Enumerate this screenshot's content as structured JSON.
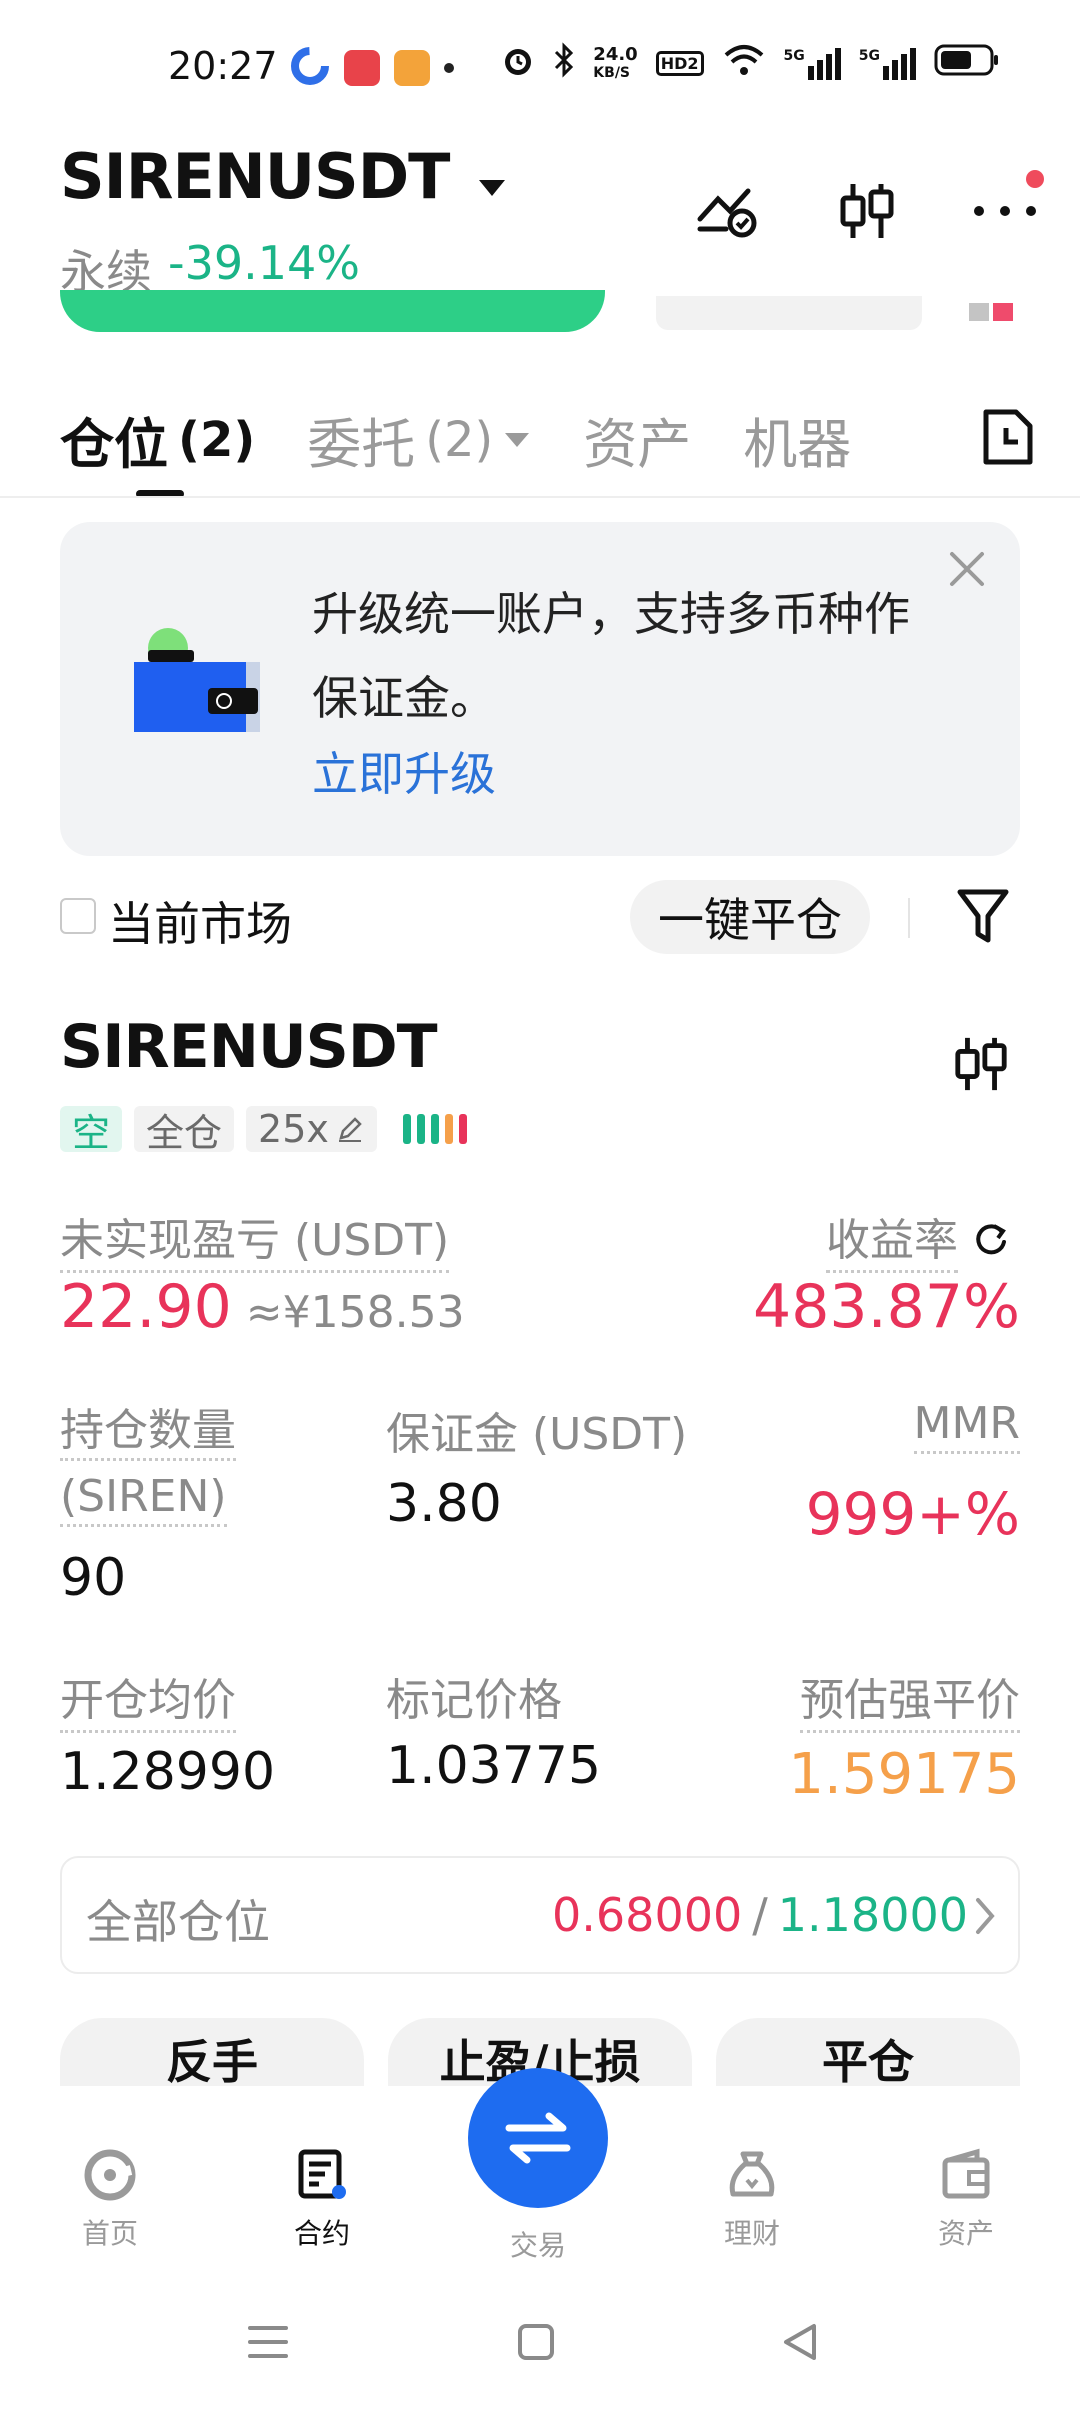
{
  "status_bar": {
    "time": "20:27",
    "net_speed_top": "24.0",
    "net_speed_unit": "KB/S",
    "hd_label": "HD2",
    "sig1": "5G",
    "sig2": "5G"
  },
  "header": {
    "pair": "SIRENUSDT",
    "contract_type": "永续",
    "change": "-39.14%"
  },
  "tabs": [
    {
      "label": "仓位",
      "count": "(2)"
    },
    {
      "label": "委托",
      "count": "(2)"
    },
    {
      "label": "资产",
      "count": ""
    },
    {
      "label": "机器",
      "count": ""
    }
  ],
  "banner": {
    "text": "升级统一账户，支持多币种作保证金。",
    "link": "立即升级"
  },
  "filter": {
    "current_market": "当前市场",
    "close_all": "一键平仓"
  },
  "position": {
    "symbol": "SIRENUSDT",
    "side": "空",
    "margin_mode": "全仓",
    "leverage": "25x",
    "upnl_label": "未实现盈亏 (USDT)",
    "upnl": "22.90",
    "upnl_cny": "≈¥158.53",
    "roe_label": "收益率",
    "roe": "483.87%",
    "qty_label_1": "持仓数量",
    "qty_label_2": "(SIREN)",
    "qty": "90",
    "margin_label": "保证金 (USDT)",
    "margin": "3.80",
    "mmr_label": "MMR",
    "mmr": "999+%",
    "entry_label": "开仓均价",
    "entry": "1.28990",
    "mark_label": "标记价格",
    "mark": "1.03775",
    "liq_label": "预估强平价",
    "liq": "1.59175"
  },
  "all_positions": {
    "label": "全部仓位",
    "val_short": "0.68000",
    "sep": "/",
    "val_long": "1.18000"
  },
  "actions": {
    "reverse": "反手",
    "tpsl": "止盈/止损",
    "close": "平仓"
  },
  "bottom_nav": {
    "home": "首页",
    "futures": "合约",
    "trade": "交易",
    "earn": "理财",
    "assets": "资产"
  },
  "colors": {
    "red": "#e8335a",
    "green": "#1bb487",
    "blue": "#1e6cf0",
    "orange": "#f5a04a"
  }
}
